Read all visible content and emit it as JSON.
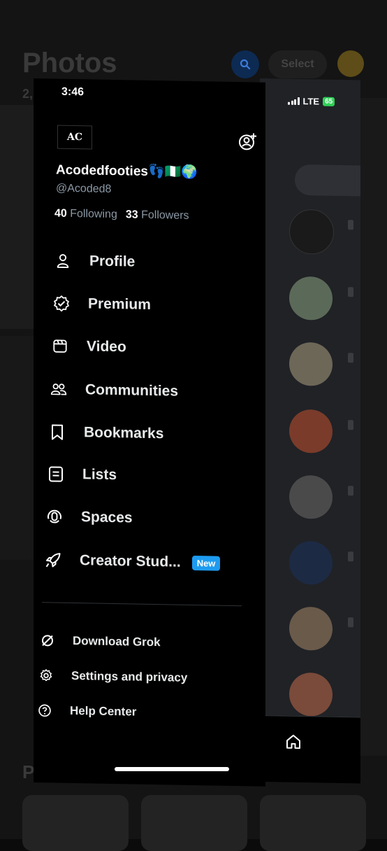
{
  "background_app": {
    "title": "Photos",
    "subtitle": "2,",
    "select_label": "Select",
    "section_people": "People"
  },
  "status_bar": {
    "time": "3:46",
    "network": "LTE",
    "battery": "65"
  },
  "profile": {
    "display_name": "Acodedfooties👣🇳🇬🌍",
    "handle": "@Acoded8",
    "following_count": "40",
    "following_label": "Following",
    "followers_count": "33",
    "followers_label": "Followers"
  },
  "menu": {
    "items": [
      {
        "label": "Profile",
        "icon": "person-icon"
      },
      {
        "label": "Premium",
        "icon": "verified-badge-icon"
      },
      {
        "label": "Video",
        "icon": "video-icon"
      },
      {
        "label": "Communities",
        "icon": "communities-icon"
      },
      {
        "label": "Bookmarks",
        "icon": "bookmark-icon"
      },
      {
        "label": "Lists",
        "icon": "lists-icon"
      },
      {
        "label": "Spaces",
        "icon": "spaces-icon"
      },
      {
        "label": "Creator Stud...",
        "icon": "rocket-icon",
        "badge": "New"
      }
    ]
  },
  "secondary": {
    "items": [
      {
        "label": "Download Grok",
        "icon": "grok-icon"
      },
      {
        "label": "Settings and privacy",
        "icon": "gear-icon"
      },
      {
        "label": "Help Center",
        "icon": "help-icon"
      }
    ]
  },
  "colors": {
    "accent": "#1d9bf0",
    "drawer_bg": "#000000",
    "muted_text": "#8b98a5",
    "battery": "#30d158"
  }
}
